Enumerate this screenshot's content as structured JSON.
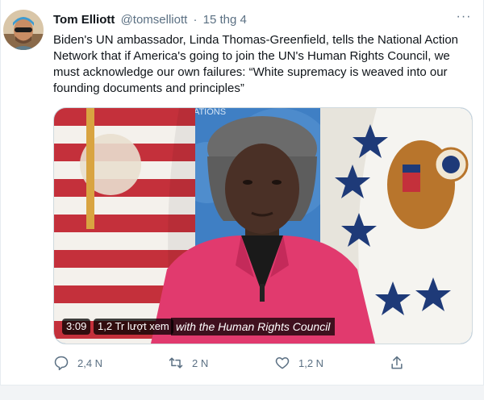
{
  "tweet": {
    "author_name": "Tom Elliott",
    "author_handle": "@tomselliott",
    "separator": "·",
    "date": "15 thg 4",
    "more_glyph": "···",
    "text": "Biden's UN ambassador, Linda Thomas-Greenfield, tells the National Action Network that if America's going to join the UN's Human Rights Council, we must acknowledge our own failures: “White supremacy is weaved into our founding documents and principles”"
  },
  "video": {
    "duration": "3:09",
    "views": "1,2 Tr lượt xem",
    "caption": "with the Human Rights Council",
    "backdrop_text": "NATIONS"
  },
  "actions": {
    "reply_count": "2,4 N",
    "retweet_count": "2 N",
    "like_count": "1,2 N",
    "icons": [
      "reply-icon",
      "retweet-icon",
      "like-icon",
      "share-icon"
    ]
  },
  "colors": {
    "text_primary": "#0f1419",
    "text_secondary": "#5b7083",
    "border": "#cfd9de",
    "jacket_pink": "#e13a6e",
    "un_blue": "#3f7fc4"
  }
}
